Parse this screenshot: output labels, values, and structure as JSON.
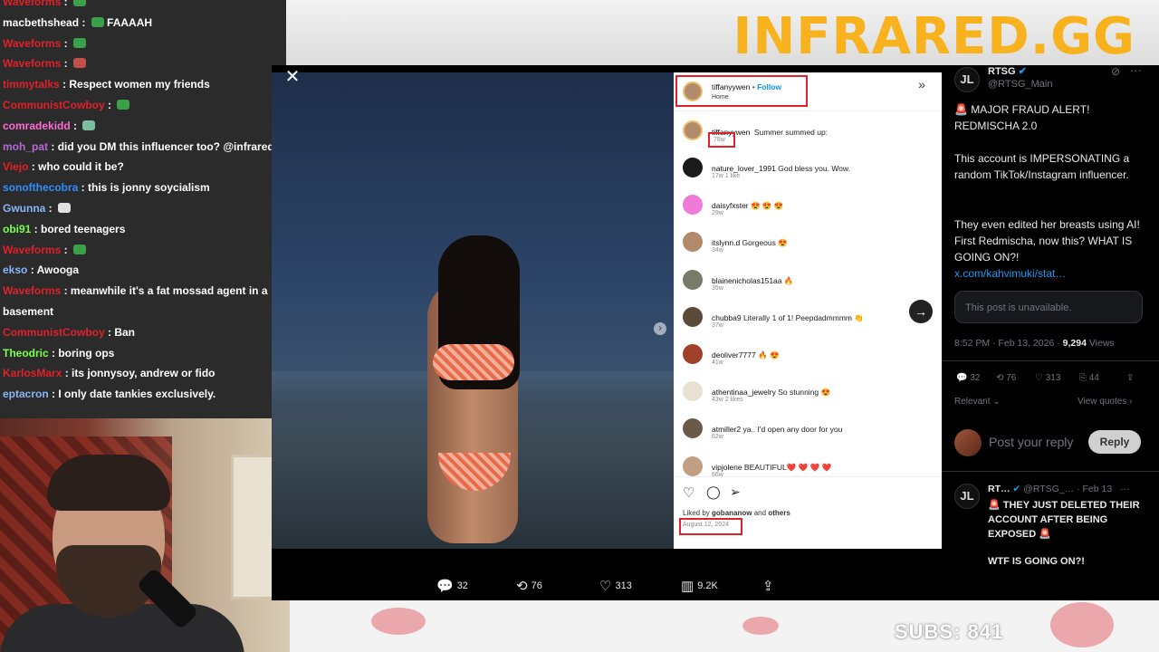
{
  "brand": "INFRARED.GG",
  "chat": {
    "messages": [
      {
        "user": "Waveforms",
        "color": "#e0202a",
        "text": "",
        "emote": "#3aa04a"
      },
      {
        "user": "macbethshead",
        "color": "#ffffff",
        "text": "FAAAAH",
        "emote": "#3aa04a"
      },
      {
        "user": "Waveforms",
        "color": "#e0202a",
        "text": "",
        "emote": "#3aa04a"
      },
      {
        "user": "Waveforms",
        "color": "#e0202a",
        "text": "",
        "emote": "#c0504a"
      },
      {
        "user": "timmytalks",
        "color": "#e0202a",
        "text": "Respect women my friends",
        "emote": ""
      },
      {
        "user": "CommunistCowboy",
        "color": "#e0202a",
        "text": "",
        "emote": "#3aa04a"
      },
      {
        "user": "comradekidd",
        "color": "#ff6ad5",
        "text": "",
        "emote": "#7ac0a0"
      },
      {
        "user": "moh_pat",
        "color": "#b06ad5",
        "text": "did you DM this influencer too? @infrared",
        "emote": ""
      },
      {
        "user": "Viejo",
        "color": "#e0202a",
        "text": "who could it be?",
        "emote": ""
      },
      {
        "user": "sonofthecobra",
        "color": "#2f8cff",
        "text": "this is jonny soycialism",
        "emote": ""
      },
      {
        "user": "Gwunna",
        "color": "#8ab4f8",
        "text": "",
        "emote": "#e0e0e0"
      },
      {
        "user": "obi91",
        "color": "#7cff4a",
        "text": "bored teenagers",
        "emote": ""
      },
      {
        "user": "Waveforms",
        "color": "#e0202a",
        "text": "",
        "emote": "#3aa04a"
      },
      {
        "user": "ekso",
        "color": "#8ab4f8",
        "text": "Awooga",
        "emote": ""
      },
      {
        "user": "Waveforms",
        "color": "#e0202a",
        "text": "meanwhile it's a fat mossad agent in a",
        "emote": ""
      },
      {
        "user": "",
        "color": "#ffffff",
        "text": "basement",
        "emote": ""
      },
      {
        "user": "CommunistCowboy",
        "color": "#e0202a",
        "text": "Ban",
        "emote": ""
      },
      {
        "user": "Theodric",
        "color": "#7cff4a",
        "text": "boring ops",
        "emote": ""
      },
      {
        "user": "KarlosMarx",
        "color": "#e0202a",
        "text": "its jonnysoy, andrew or fido",
        "emote": ""
      },
      {
        "user": "eptacron",
        "color": "#8ab4f8",
        "text": "I only date tankies exclusively.",
        "emote": ""
      }
    ]
  },
  "instagram": {
    "poster": "tiffanyywen",
    "follow": "Follow",
    "location": "Home",
    "caption_user": "tiffanyywen",
    "caption": "Summer summed up:",
    "caption_age": "78w",
    "comments": [
      {
        "user": "nature_lover_1991",
        "text": "God bless you. Wow.",
        "meta": "17w   1 like",
        "avatar": "#1a1a1a"
      },
      {
        "user": "daisyfxster",
        "text": "😍 😍 😍",
        "meta": "29w",
        "avatar": "#f07ad8"
      },
      {
        "user": "itslynn.d",
        "text": "Gorgeous 😍",
        "meta": "34w",
        "avatar": "#b08a6a"
      },
      {
        "user": "blainenicholas151aa",
        "text": "🔥",
        "meta": "35w",
        "avatar": "#7a7a6a"
      },
      {
        "user": "chubba9",
        "text": "Literally 1 of 1! Peepdadmmmm 👏",
        "meta": "37w",
        "avatar": "#5a4a3a"
      },
      {
        "user": "deoliver7777",
        "text": "🔥 😍",
        "meta": "41w",
        "avatar": "#a0402a"
      },
      {
        "user": "athentinaa_jewelry",
        "text": "So stunning 😍",
        "meta": "43w   2 likes",
        "avatar": "#e8e0d0"
      },
      {
        "user": "atmiller2",
        "text": "ya.. I'd open any door for you",
        "meta": "62w",
        "avatar": "#6a5a4a"
      },
      {
        "user": "vipjolene",
        "text": "BEAUTIFUL❤️ ❤️ ❤️ ❤️",
        "meta": "66w",
        "avatar": "#c0a080"
      }
    ],
    "liked_by_prefix": "Liked by",
    "liked_by_user": "gobananow",
    "liked_by_and": "and",
    "liked_by_others": "others",
    "date": "August 12, 2024"
  },
  "post_actions": {
    "replies": "32",
    "reposts": "76",
    "likes": "313",
    "views": "9.2K"
  },
  "twitter": {
    "avatar_label": "JL",
    "name": "RTSG",
    "handle": "@RTSG_Main",
    "body_1": "🚨 MAJOR FRAUD ALERT! REDMISCHA 2.0",
    "body_2": "This account is IMPERSONATING a random TikTok/Instagram influencer.",
    "body_3": "They even edited her breasts using AI! First Redmischa, now this? WHAT IS GOING ON?!",
    "link": "x.com/kahvimuki/stat…",
    "unavailable": "This post is unavailable.",
    "time": "8:52 PM · Feb 13, 2026 ·",
    "views_count": "9,294",
    "views_label": "Views",
    "replies": "32",
    "reposts": "76",
    "likes": "313",
    "bookmarks": "44",
    "relevant": "Relevant",
    "view_quotes": "View quotes",
    "reply_placeholder": "Post your reply",
    "reply_button": "Reply",
    "reply_name": "RT…",
    "reply_handle": "@RTSG_… · Feb 13",
    "reply_body_1": "🚨 THEY JUST DELETED THEIR ACCOUNT AFTER BEING EXPOSED 🚨",
    "reply_body_2": "WTF IS GOING ON?!"
  },
  "subs": "SUBS: 841"
}
